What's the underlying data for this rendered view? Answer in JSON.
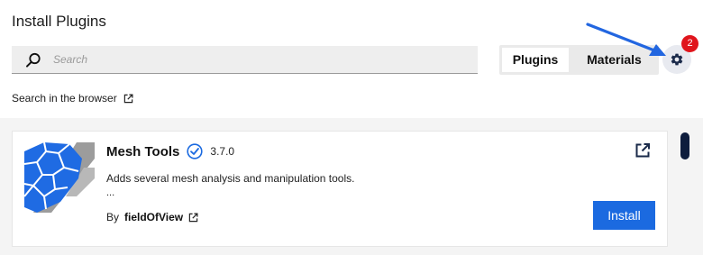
{
  "header": {
    "title": "Install Plugins"
  },
  "search": {
    "placeholder": "Search",
    "value": ""
  },
  "tabs": [
    {
      "label": "Plugins",
      "selected": true
    },
    {
      "label": "Materials",
      "selected": false
    }
  ],
  "settings": {
    "badge_count": "2",
    "icon": "gear-icon",
    "annotation": "blue-arrow-pointing-to-gear"
  },
  "browser_link": {
    "label": "Search in the browser",
    "icon": "external-link-icon"
  },
  "plugins": [
    {
      "name": "Mesh Tools",
      "verified": true,
      "version": "3.7.0",
      "description": "Adds several mesh analysis and manipulation tools.",
      "description_more": "...",
      "by_label": "By",
      "author": "fieldOfView",
      "install_label": "Install"
    }
  ],
  "colors": {
    "accent": "#1b6ae0",
    "badge": "#e0151c",
    "annotation_arrow": "#2266e0",
    "scrollbar_thumb": "#0e1d3d"
  }
}
